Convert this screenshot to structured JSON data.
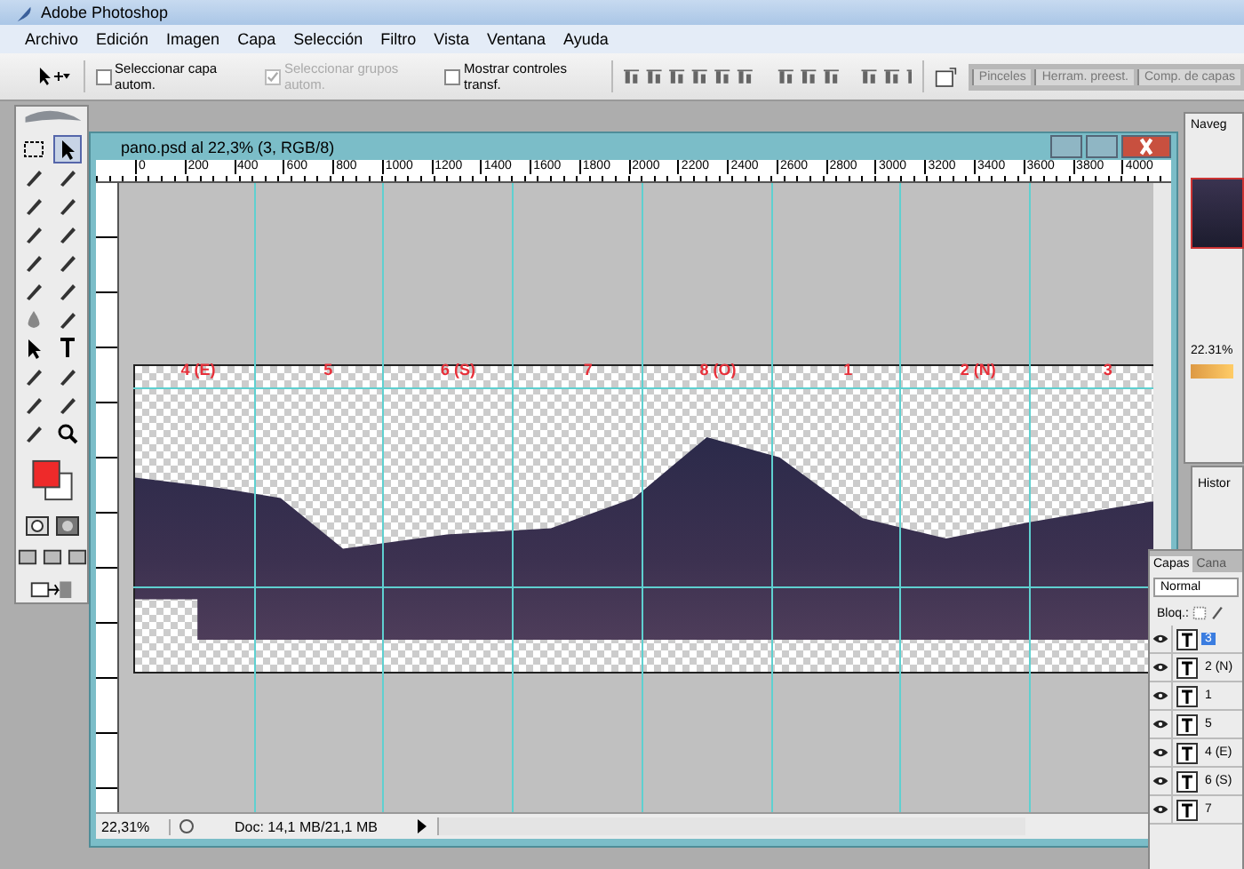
{
  "window": {
    "title": "Adobe Photoshop"
  },
  "menu": [
    "Archivo",
    "Edición",
    "Imagen",
    "Capa",
    "Selección",
    "Filtro",
    "Vista",
    "Ventana",
    "Ayuda"
  ],
  "options": {
    "checkboxes": [
      {
        "label": "Seleccionar capa autom.",
        "checked": false,
        "disabled": false
      },
      {
        "label": "Seleccionar grupos autom.",
        "checked": true,
        "disabled": true
      },
      {
        "label": "Mostrar controles transf.",
        "checked": false,
        "disabled": false
      }
    ],
    "panel_tabs": [
      "Pinceles",
      "Herram. preest.",
      "Comp. de capas"
    ]
  },
  "document": {
    "title": "pano.psd al 22,3% (3, RGB/8)",
    "ruler_labels": [
      "0",
      "200",
      "400",
      "600",
      "800",
      "1000",
      "1200",
      "1400",
      "1600",
      "1800",
      "2000",
      "2200",
      "2400",
      "2600",
      "2800",
      "3000",
      "3200",
      "3400",
      "3600",
      "3800",
      "4000"
    ],
    "section_labels": [
      "4 (E)",
      "5",
      "6 (S)",
      "7",
      "8 (O)",
      "1",
      "2 (N)",
      "3"
    ],
    "zoom": "22,31%",
    "doc_info": "Doc: 14,1 MB/21,1 MB"
  },
  "navigator": {
    "tab": "Naveg",
    "zoom": "22.31%"
  },
  "history": {
    "tab": "Histor"
  },
  "layers_panel": {
    "tabs": [
      {
        "label": "Capas",
        "selected": true
      },
      {
        "label": "Cana",
        "selected": false
      }
    ],
    "blend_mode": "Normal",
    "lock_label": "Bloq.:",
    "layers": [
      {
        "name": "3",
        "visible": true,
        "selected": true
      },
      {
        "name": "2 (N)",
        "visible": true,
        "selected": false
      },
      {
        "name": "1",
        "visible": true,
        "selected": false
      },
      {
        "name": "5",
        "visible": true,
        "selected": false
      },
      {
        "name": "4 (E)",
        "visible": true,
        "selected": false
      },
      {
        "name": "6 (S)",
        "visible": true,
        "selected": false
      },
      {
        "name": "7",
        "visible": true,
        "selected": false
      }
    ]
  }
}
